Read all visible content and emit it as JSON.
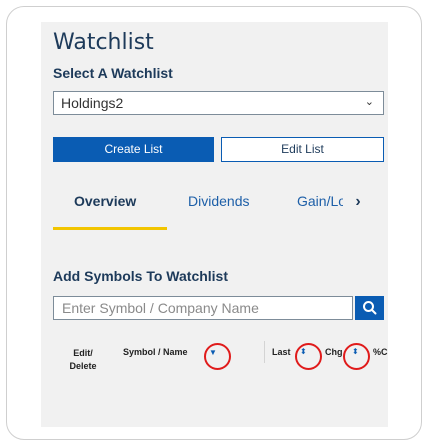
{
  "watchlist": {
    "title": "Watchlist",
    "select_label": "Select A Watchlist",
    "selected": "Holdings2",
    "caret": "⌄"
  },
  "buttons": {
    "create": "Create List",
    "edit": "Edit List"
  },
  "tabs": [
    {
      "label": "Overview",
      "active": true
    },
    {
      "label": "Dividends",
      "active": false
    },
    {
      "label": "Gain/Loss",
      "active": false
    }
  ],
  "tab_next": "›",
  "add_symbols": {
    "title": "Add Symbols To Watchlist",
    "placeholder": "Enter Symbol / Company Name",
    "search_icon": "search-icon"
  },
  "table": {
    "columns": [
      "Edit/ Delete",
      "Symbol / Name",
      "Last",
      "Chg",
      "%Chg"
    ],
    "sort_icon_down": "▼",
    "sort_icon_updown": "⬍"
  },
  "colors": {
    "primary": "#0a5cb3",
    "title": "#1d3a5a",
    "tab_link": "#1d5fa8",
    "active_tab_underline": "#f2c500",
    "panel_bg": "#f1f1f1",
    "annotation_circle": "#e01b1b"
  }
}
